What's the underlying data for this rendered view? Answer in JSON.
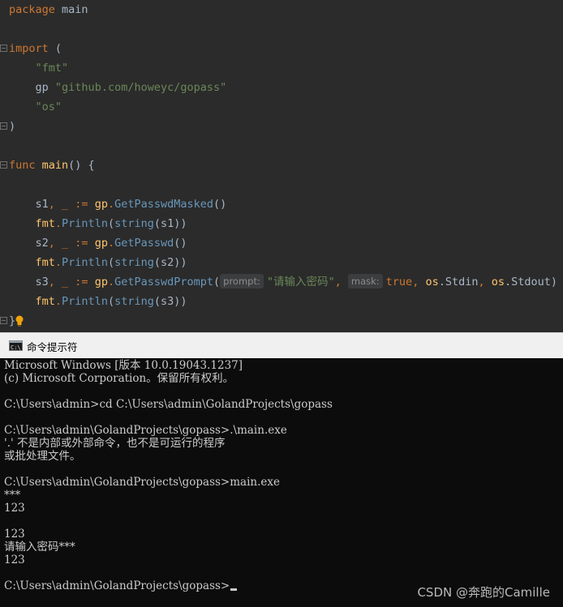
{
  "editor": {
    "l1_kw": "package",
    "l1_name": "main",
    "l3_kw": "import",
    "l3_paren": "(",
    "l4_str": "\"fmt\"",
    "l5_alias": "gp",
    "l5_str": "\"github.com/howeyc/gopass\"",
    "l6_str": "\"os\"",
    "l7_paren": ")",
    "l9_kw": "func",
    "l9_fn": "main",
    "l9_rest": "() {",
    "l11_vars": "s1",
    "l11_rest": ", _ := ",
    "l11_pkg": "gp",
    "l11_call": "GetPasswdMasked",
    "l11_tail": "()",
    "l12_pkg": "fmt",
    "l12_call": "Println",
    "l12_arg_fn": "string",
    "l12_arg": "(s1))",
    "l13_vars": "s2",
    "l13_rest": ", _ := ",
    "l13_pkg": "gp",
    "l13_call": "GetPasswd",
    "l13_tail": "()",
    "l14_pkg": "fmt",
    "l14_call": "Println",
    "l14_arg_fn": "string",
    "l14_arg": "(s2))",
    "l15_vars": "s3",
    "l15_rest": ", _ := ",
    "l15_pkg": "gp",
    "l15_call": "GetPasswdPrompt",
    "l15_open": "(",
    "l15_hint1": "prompt:",
    "l15_str": "\"请输入密码\"",
    "l15_comma1": ", ",
    "l15_hint2": "mask:",
    "l15_true": "true",
    "l15_comma2": ", ",
    "l15_os1": "os",
    "l15_stdin": ".Stdin",
    "l15_comma3": ", ",
    "l15_os2": "os",
    "l15_stdout": ".Stdout)",
    "l16_pkg": "fmt",
    "l16_call": "Println",
    "l16_arg_fn": "string",
    "l16_arg": "(s3))",
    "l17_brace": "}"
  },
  "cmd": {
    "title": "命令提示符",
    "lines": [
      "Microsoft Windows [版本 10.0.19043.1237]",
      "(c) Microsoft Corporation。保留所有权利。",
      "",
      "C:\\Users\\admin>cd C:\\Users\\admin\\GolandProjects\\gopass",
      "",
      "C:\\Users\\admin\\GolandProjects\\gopass>.\\main.exe",
      "'.' 不是内部或外部命令，也不是可运行的程序",
      "或批处理文件。",
      "",
      "C:\\Users\\admin\\GolandProjects\\gopass>main.exe",
      "***",
      "123",
      "",
      "123",
      "请输入密码***",
      "123",
      "",
      "C:\\Users\\admin\\GolandProjects\\gopass>"
    ]
  },
  "watermark": "CSDN @奔跑的Camille"
}
